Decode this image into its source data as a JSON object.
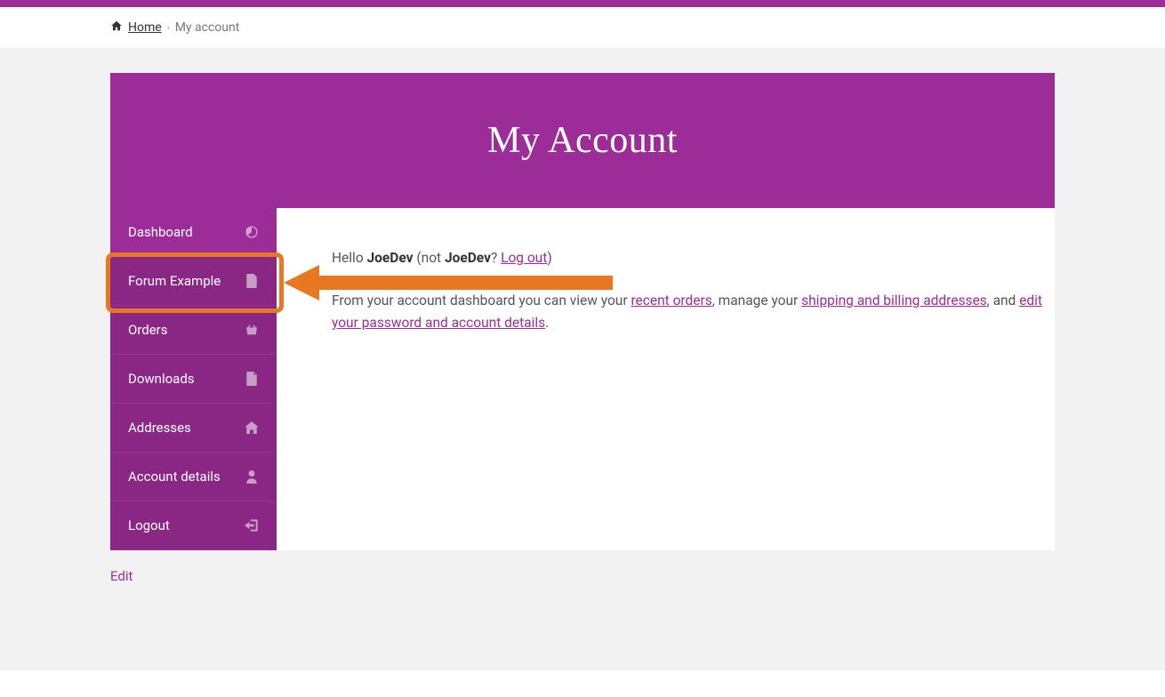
{
  "breadcrumb": {
    "home": "Home",
    "current": "My account"
  },
  "hero": {
    "title": "My Account"
  },
  "nav": {
    "items": [
      {
        "label": "Dashboard",
        "icon": "dashboard-icon"
      },
      {
        "label": "Forum Example",
        "icon": "file-icon"
      },
      {
        "label": "Orders",
        "icon": "basket-icon"
      },
      {
        "label": "Downloads",
        "icon": "file2-icon"
      },
      {
        "label": "Addresses",
        "icon": "home-icon"
      },
      {
        "label": "Account details",
        "icon": "user-icon"
      },
      {
        "label": "Logout",
        "icon": "logout-icon"
      }
    ]
  },
  "greeting": {
    "hello": "Hello ",
    "name": "JoeDev",
    "notPrefix": " (not ",
    "notName": "JoeDev",
    "notQ": "? ",
    "logout": "Log out",
    "closeParen": ")"
  },
  "intro": {
    "p1a": "From your account dashboard you can view your ",
    "link1": "recent orders",
    "p1b": ", manage your ",
    "link2": "shipping and billing addresses",
    "p1c": ", and ",
    "link3": "edit your password and account details",
    "p1d": "."
  },
  "editLink": "Edit"
}
